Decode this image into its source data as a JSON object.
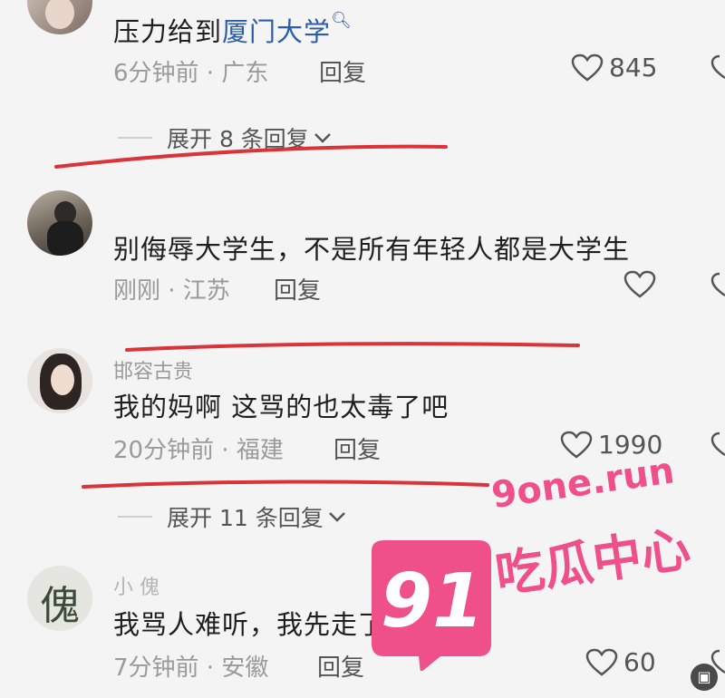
{
  "comments": [
    {
      "text_before": "压力给到",
      "link": "厦门大学",
      "meta": "6分钟前 · 广东",
      "reply": "回复",
      "likes": "845",
      "expand": "展开 8 条回复"
    },
    {
      "text": "别侮辱大学生，不是所有年轻人都是大学生",
      "meta": "刚刚 · 江苏",
      "reply": "回复",
      "likes": ""
    },
    {
      "username": "邯容古贵",
      "text": "我的妈啊  这骂的也太毒了吧",
      "meta": "20分钟前 · 福建",
      "reply": "回复",
      "likes": "1990",
      "expand": "展开 11 条回复"
    },
    {
      "username": "小  傀",
      "avatar_text": "傀",
      "text": "我骂人难听，我先走了",
      "meta": "7分钟前 · 安徽",
      "reply": "回复",
      "likes": "60"
    }
  ],
  "watermark": {
    "number": "91",
    "domain": "9one.run",
    "brand": "吃瓜中心",
    "color": "#f0508a"
  },
  "icons": [
    "heart-icon",
    "dislike-icon",
    "search-icon",
    "chevron-down-icon"
  ]
}
